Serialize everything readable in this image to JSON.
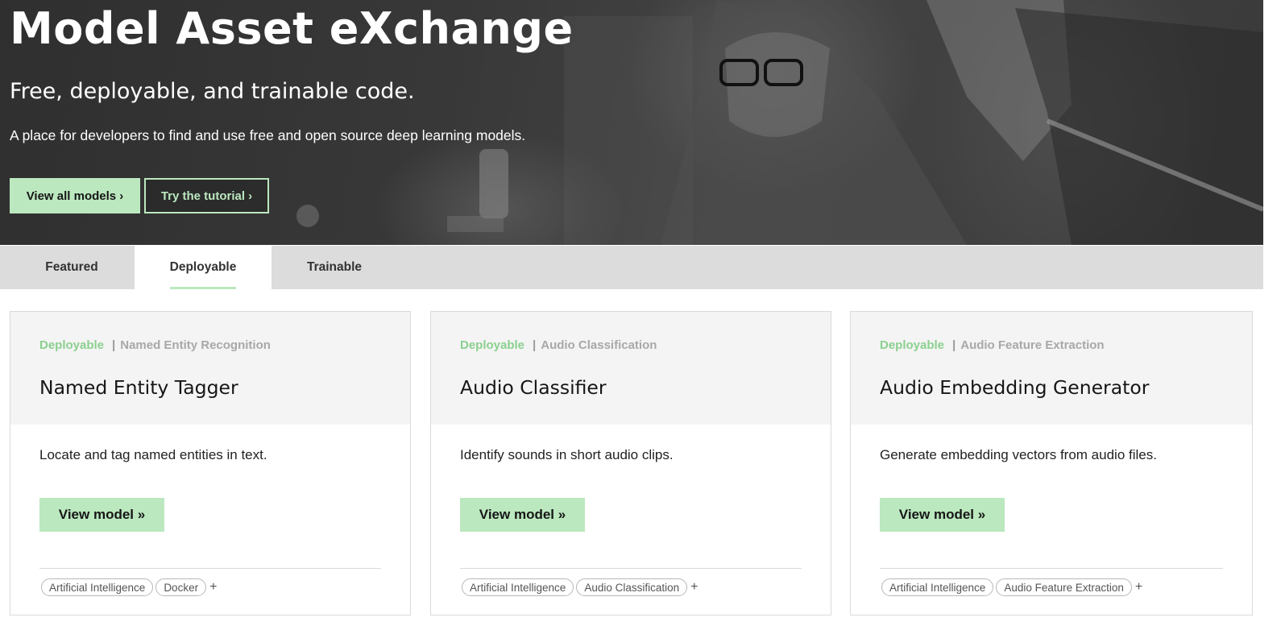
{
  "hero": {
    "title": "Model Asset eXchange",
    "subtitle": "Free, deployable, and trainable code.",
    "description": "A place for developers to find and use free and open source deep learning models.",
    "primary_button": "View all models ›",
    "secondary_button": "Try the tutorial ›"
  },
  "tabs": [
    {
      "label": "Featured",
      "active": false
    },
    {
      "label": "Deployable",
      "active": true
    },
    {
      "label": "Trainable",
      "active": false
    }
  ],
  "cards": [
    {
      "type": "Deployable",
      "separator": "|",
      "category": "Named Entity Recognition",
      "title": "Named Entity Tagger",
      "description": "Locate and tag named entities in text.",
      "button": "View model »",
      "chips": [
        "Artificial Intelligence",
        "Docker"
      ],
      "more": "+"
    },
    {
      "type": "Deployable",
      "separator": "|",
      "category": "Audio Classification",
      "title": "Audio Classifier",
      "description": "Identify sounds in short audio clips.",
      "button": "View model »",
      "chips": [
        "Artificial Intelligence",
        "Audio Classification"
      ],
      "more": "+"
    },
    {
      "type": "Deployable",
      "separator": "|",
      "category": "Audio Feature Extraction",
      "title": "Audio Embedding Generator",
      "description": "Generate embedding vectors from audio files.",
      "button": "View model »",
      "chips": [
        "Artificial Intelligence",
        "Audio Feature Extraction"
      ],
      "more": "+"
    }
  ],
  "colors": {
    "accent": "#bbe8bf",
    "accent_text": "#8bd08f",
    "tab_bar": "#dcdcdc",
    "card_header": "#f4f4f4"
  }
}
